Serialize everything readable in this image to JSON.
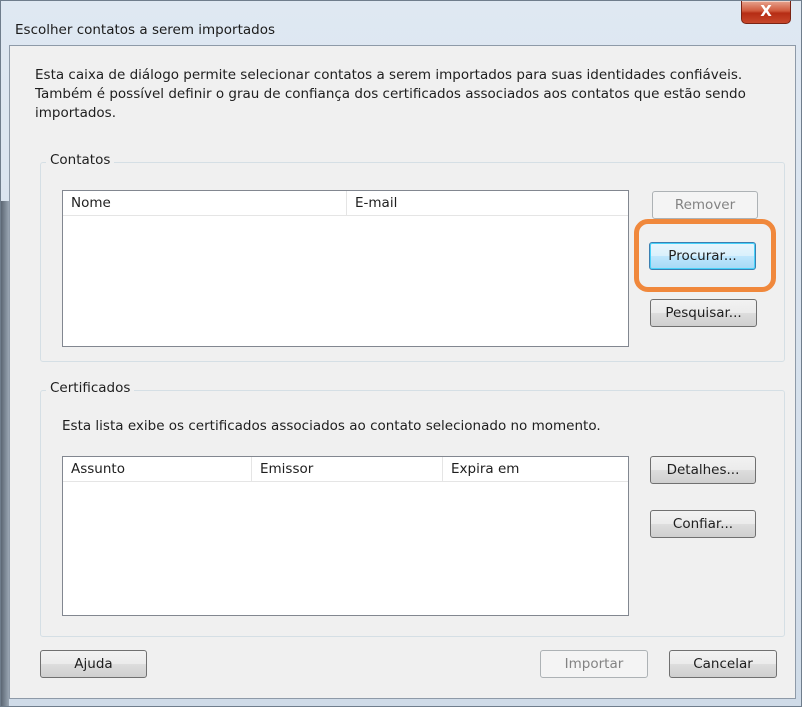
{
  "window": {
    "title": "Escolher contatos a serem importados",
    "close_glyph": "X"
  },
  "intro_text": "Esta caixa de diálogo permite selecionar contatos a serem importados para suas identidades confiáveis. Também é possível definir o grau de confiança dos certificados associados aos contatos que estão sendo importados.",
  "contacts": {
    "group_label": "Contatos",
    "columns": [
      "Nome",
      "E-mail"
    ],
    "buttons": {
      "remove": "Remover",
      "browse": "Procurar...",
      "search": "Pesquisar..."
    }
  },
  "certificates": {
    "group_label": "Certificados",
    "description": "Esta lista exibe os certificados associados ao contato selecionado no momento.",
    "columns": [
      "Assunto",
      "Emissor",
      "Expira em"
    ],
    "buttons": {
      "details": "Detalhes...",
      "trust": "Confiar..."
    }
  },
  "footer": {
    "help": "Ajuda",
    "import": "Importar",
    "cancel": "Cancelar"
  },
  "colors": {
    "highlight": "#f0883c",
    "close_button": "#c7472b",
    "default_button": "#bee6fd"
  },
  "icons": {
    "close": "close-icon"
  }
}
